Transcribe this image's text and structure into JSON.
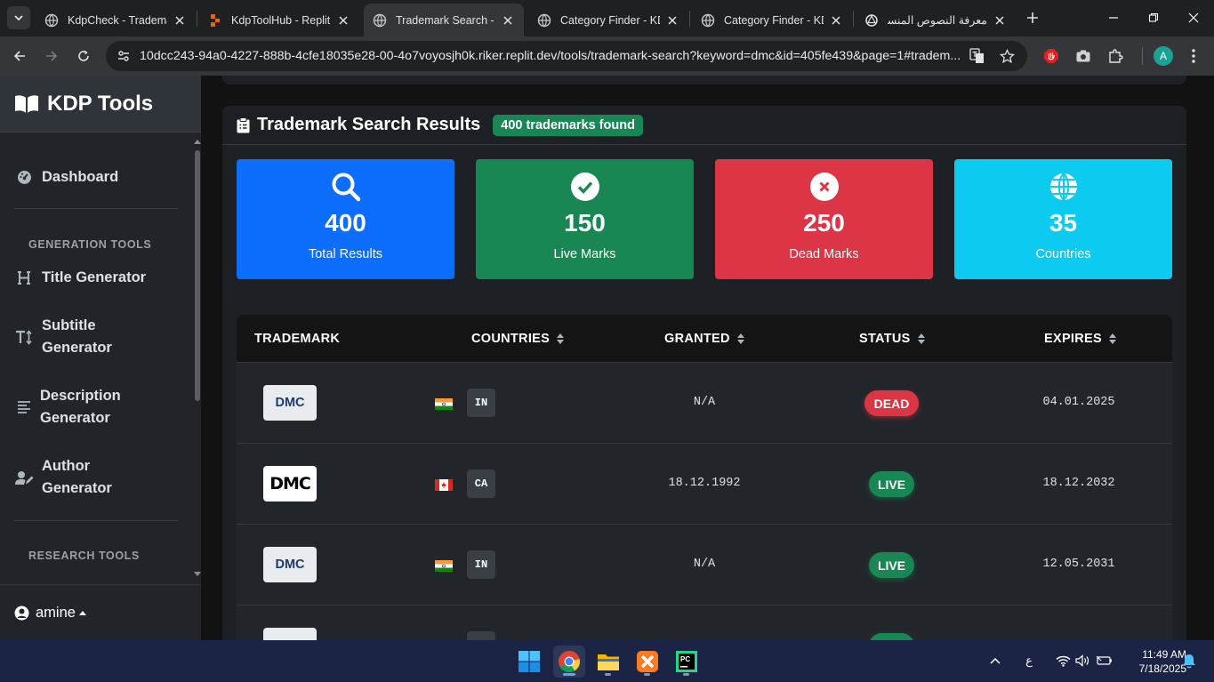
{
  "browser": {
    "tabs": [
      {
        "title": "KdpCheck - Trademark",
        "active": false
      },
      {
        "title": "KdpToolHub - Replit",
        "active": false
      },
      {
        "title": "Trademark Search - KDP",
        "active": true
      },
      {
        "title": "Category Finder - KDP",
        "active": false
      },
      {
        "title": "Category Finder - KDP",
        "active": false
      },
      {
        "title": "معرفة النصوص المنسوخة",
        "active": false
      }
    ],
    "url": "10dcc243-94a0-4227-888b-4cfe18035e28-00-4o7voyosjh0k.riker.replit.dev/tools/trademark-search?keyword=dmc&id=405fe439&page=1#tradem...",
    "profile_initial": "A"
  },
  "sidebar": {
    "brand": "KDP Tools",
    "dashboard": "Dashboard",
    "generation_heading": "GENERATION TOOLS",
    "generation_items": [
      {
        "label": "Title Generator",
        "icon": "heading-icon"
      },
      {
        "label": "Subtitle Generator",
        "icon": "text-height-icon"
      },
      {
        "label": "Description Generator",
        "icon": "align-left-icon"
      },
      {
        "label": "Author Generator",
        "icon": "user-pen-icon"
      }
    ],
    "research_heading": "RESEARCH TOOLS",
    "user": "amine"
  },
  "results": {
    "title": "Trademark Search Results",
    "badge": "400 trademarks found"
  },
  "stats": [
    {
      "value": "400",
      "label": "Total Results",
      "color": "#0d6efd",
      "icon": "search-icon"
    },
    {
      "value": "150",
      "label": "Live Marks",
      "color": "#198754",
      "icon": "check-circle-icon"
    },
    {
      "value": "250",
      "label": "Dead Marks",
      "color": "#dc3545",
      "icon": "x-circle-icon"
    },
    {
      "value": "35",
      "label": "Countries",
      "color": "#0dcaf0",
      "icon": "globe-icon"
    }
  ],
  "table": {
    "headers": {
      "trademark": "TRADEMARK",
      "countries": "COUNTRIES",
      "granted": "GRANTED",
      "status": "STATUS",
      "expires": "EXPIRES"
    },
    "rows": [
      {
        "mark": "DMC",
        "logo_style": "plain",
        "country": "IN",
        "flag": "india-flag",
        "granted": "N/A",
        "status": "DEAD",
        "expires": "04.01.2025"
      },
      {
        "mark": "DMC",
        "logo_style": "stylized",
        "country": "CA",
        "flag": "canada-flag",
        "granted": "18.12.1992",
        "status": "LIVE",
        "expires": "18.12.2032"
      },
      {
        "mark": "DMC",
        "logo_style": "plain",
        "country": "IN",
        "flag": "india-flag",
        "granted": "N/A",
        "status": "LIVE",
        "expires": "12.05.2031"
      }
    ]
  },
  "taskbar": {
    "time": "11:49 AM",
    "date": "7/18/2025",
    "lang": "ع"
  }
}
